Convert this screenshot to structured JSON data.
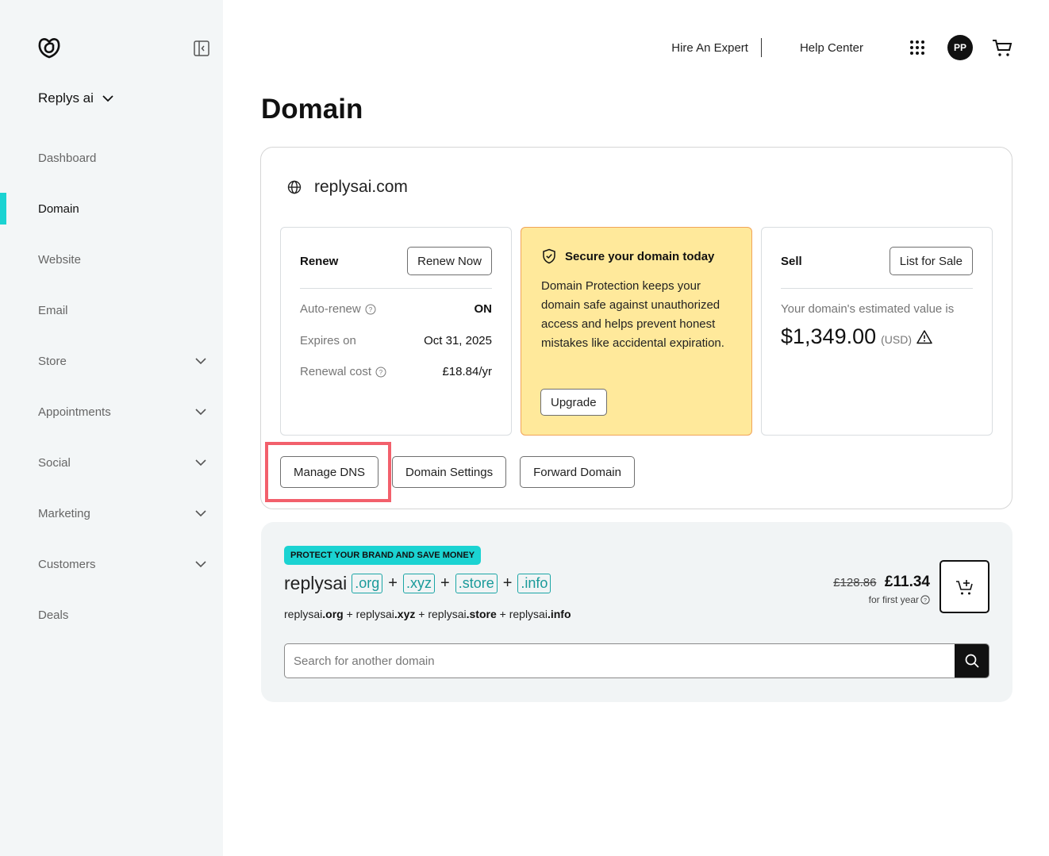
{
  "sidebar": {
    "account_name": "Replys ai",
    "items": [
      {
        "label": "Dashboard",
        "expandable": false,
        "active": false
      },
      {
        "label": "Domain",
        "expandable": false,
        "active": true
      },
      {
        "label": "Website",
        "expandable": false,
        "active": false
      },
      {
        "label": "Email",
        "expandable": false,
        "active": false
      },
      {
        "label": "Store",
        "expandable": true,
        "active": false
      },
      {
        "label": "Appointments",
        "expandable": true,
        "active": false
      },
      {
        "label": "Social",
        "expandable": true,
        "active": false
      },
      {
        "label": "Marketing",
        "expandable": true,
        "active": false
      },
      {
        "label": "Customers",
        "expandable": true,
        "active": false
      },
      {
        "label": "Deals",
        "expandable": false,
        "active": false
      }
    ]
  },
  "topbar": {
    "hire_expert": "Hire An Expert",
    "help_center": "Help Center",
    "avatar_initials": "PP"
  },
  "page": {
    "title": "Domain"
  },
  "domain": {
    "name": "replysai.com",
    "renew": {
      "label": "Renew",
      "button": "Renew Now",
      "auto_renew_label": "Auto-renew",
      "auto_renew_value": "ON",
      "expires_label": "Expires on",
      "expires_value": "Oct 31, 2025",
      "cost_label": "Renewal cost",
      "cost_value": "£18.84/yr"
    },
    "protect": {
      "title": "Secure your domain today",
      "body": "Domain Protection keeps your domain safe against unauthorized access and helps prevent honest mistakes like accidental expiration.",
      "button": "Upgrade"
    },
    "sell": {
      "label": "Sell",
      "button": "List for Sale",
      "subtitle": "Your domain's estimated value is",
      "value": "$1,349.00",
      "currency": "(USD)"
    },
    "actions": {
      "manage_dns": "Manage DNS",
      "domain_settings": "Domain Settings",
      "forward_domain": "Forward Domain"
    }
  },
  "promo": {
    "badge": "PROTECT YOUR BRAND AND SAVE MONEY",
    "base": "replysai",
    "tlds": [
      ".org",
      ".xyz",
      ".store",
      ".info"
    ],
    "plus": "+",
    "list": [
      {
        "base": "replysai",
        "tld": ".org"
      },
      {
        "base": "replysai",
        "tld": ".xyz"
      },
      {
        "base": "replysai",
        "tld": ".store"
      },
      {
        "base": "replysai",
        "tld": ".info"
      }
    ],
    "old_price": "£128.86",
    "new_price": "£11.34",
    "price_note": "for first year",
    "search_placeholder": "Search for another domain"
  },
  "colors": {
    "accent": "#1bd3d2",
    "protect_bg": "#ffe99b",
    "highlight": "#f2606c"
  }
}
